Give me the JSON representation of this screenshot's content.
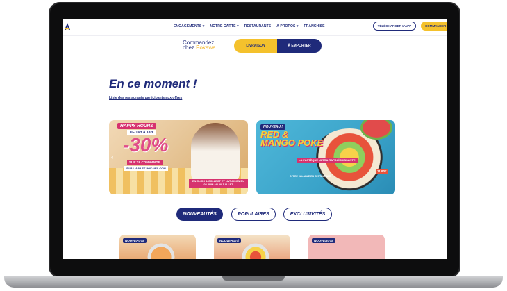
{
  "nav": {
    "items": [
      "ENGAGEMENTS ▾",
      "NOTRE CARTE ▾",
      "RESTAURANTS",
      "À PROPOS ▾",
      "FRANCHISE"
    ],
    "app_button": "TÉLÉCHARGER L'APP",
    "order_button": "COMMANDER"
  },
  "order": {
    "title_line1": "Commandez",
    "title_line2a": "chez ",
    "title_brand": "Pokawa",
    "left_option": "LIVRAISON",
    "right_option": "À EMPORTER"
  },
  "main": {
    "heading": "En ce moment !",
    "list_link": "Liste des restaurants participants aux offres"
  },
  "banner_left": {
    "badge": "HAPPY HOURS",
    "hours": "DE 14H À 18H",
    "discount": "-30%",
    "sub1": "SUR TA COMMANDE",
    "sub2": "SUR L'APP ET POKAWA.COM",
    "footnote": "EN CLICK & COLLECT ET LIVRAISON DU 08 JUIN AU 20 JUILLET",
    "arrow": "‹"
  },
  "banner_right": {
    "badge": "NOUVEAU !",
    "title_line1": "RED &",
    "title_line2": "MANGO POKE",
    "tagline": "LA PASTÈQUE ULTRA RAFRAÎCHISSANTE",
    "price": "11,90€",
    "footnote": "OFFRE VALABLE EN RESTAURANT"
  },
  "tabs": [
    "NOUVEAUTÉS",
    "POPULAIRES",
    "EXCLUSIVITÉS"
  ],
  "cards": [
    {
      "tag": "NOUVEAUTÉ"
    },
    {
      "tag": "NOUVEAUTÉ"
    },
    {
      "tag": "NOUVEAUTÉ"
    }
  ],
  "colors": {
    "brand_blue": "#1f2a7a",
    "brand_yellow": "#f4c12c",
    "accent_pink": "#d6326e"
  }
}
